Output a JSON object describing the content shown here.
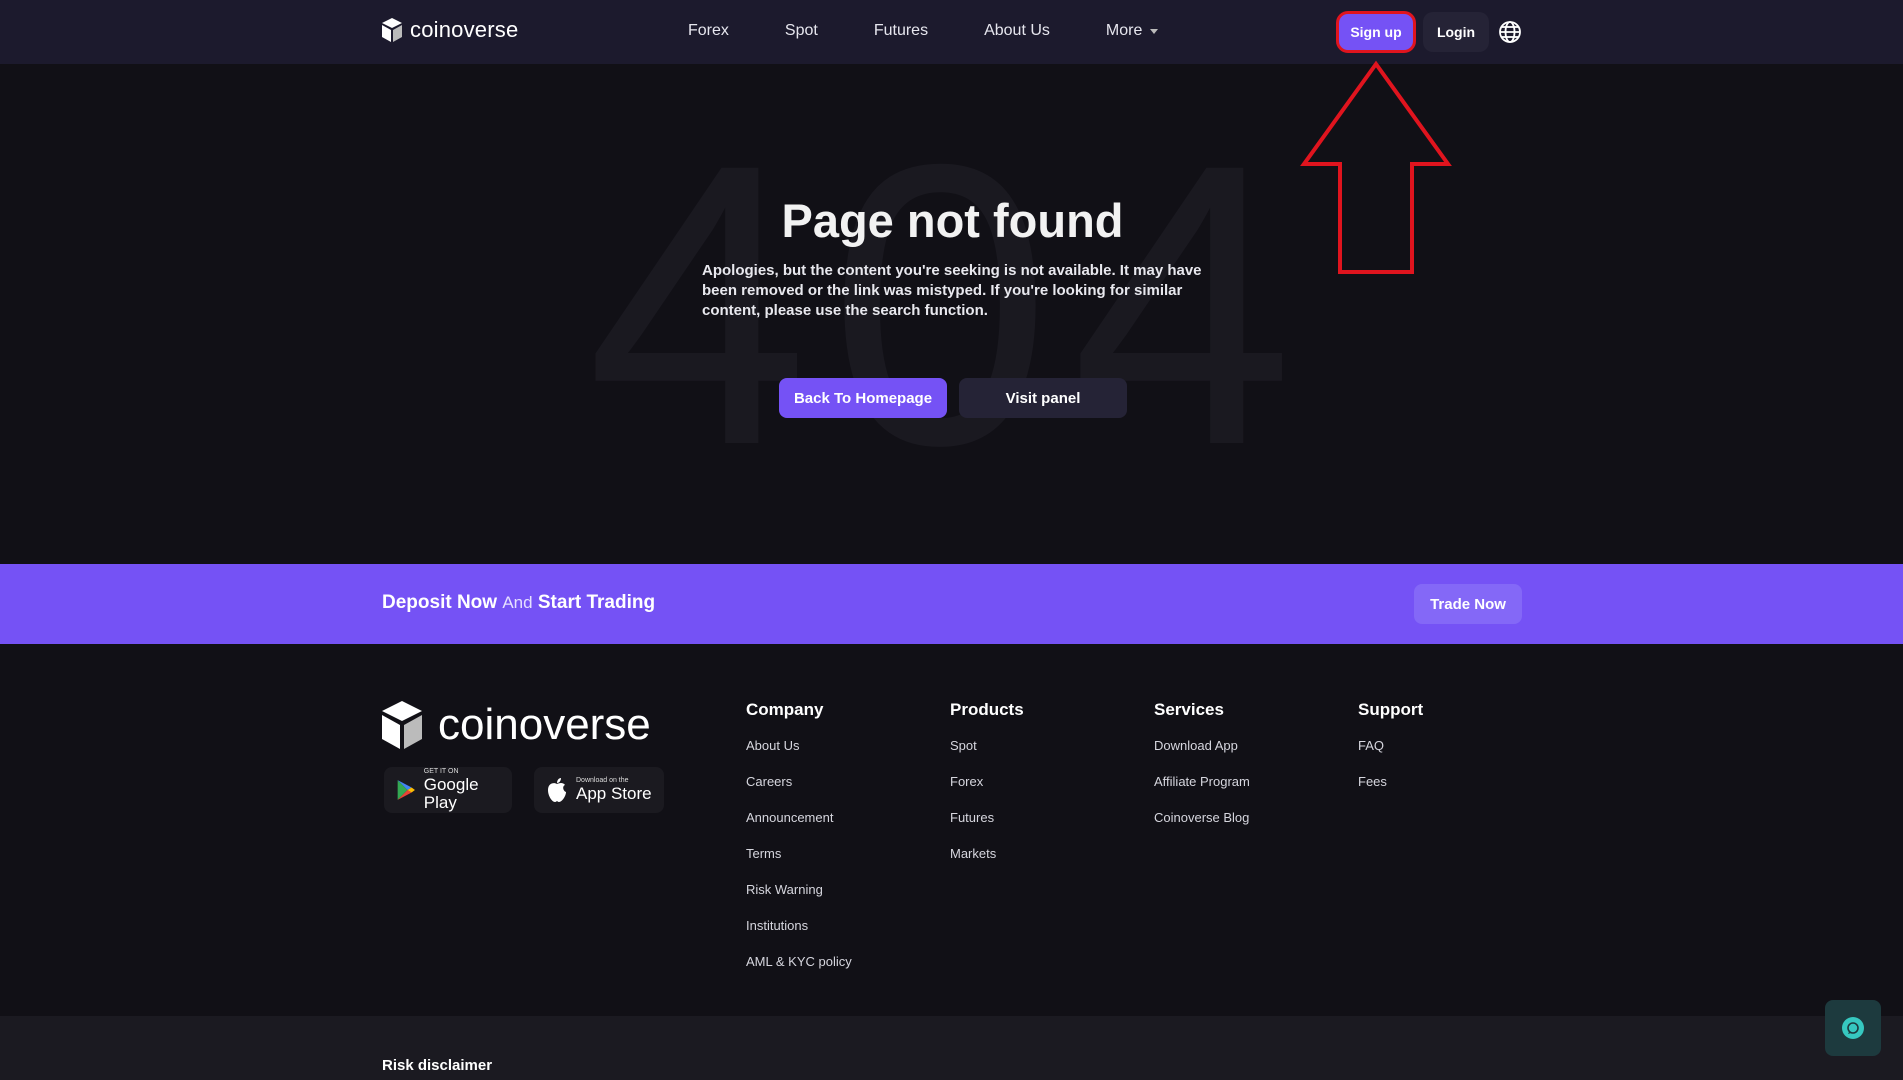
{
  "header": {
    "logo_text": "coinoverse",
    "nav": [
      "Forex",
      "Spot",
      "Futures",
      "About Us",
      "More"
    ],
    "signup_label": "Sign up",
    "login_label": "Login"
  },
  "hero": {
    "bg_text": "404",
    "title": "Page not found",
    "description": "Apologies, but the content you're seeking is not available. It may have been removed or the link was mistyped. If you're looking for similar content, please use the search function.",
    "home_button": "Back To Homepage",
    "panel_button": "Visit panel"
  },
  "banner": {
    "deposit": "Deposit Now",
    "and": "And",
    "start": "Start Trading",
    "trade_button": "Trade Now"
  },
  "footer": {
    "logo_text": "coinoverse",
    "google_play": {
      "small": "GET IT ON",
      "big": "Google Play"
    },
    "app_store": {
      "small": "Download on the",
      "big": "App Store"
    },
    "columns": [
      {
        "title": "Company",
        "items": [
          "About Us",
          "Careers",
          "Announcement",
          "Terms",
          "Risk Warning",
          "Institutions",
          "AML & KYC policy"
        ]
      },
      {
        "title": "Products",
        "items": [
          "Spot",
          "Forex",
          "Futures",
          "Markets"
        ]
      },
      {
        "title": "Services",
        "items": [
          "Download App",
          "Affiliate Program",
          "Coinoverse Blog"
        ]
      },
      {
        "title": "Support",
        "items": [
          "FAQ",
          "Fees"
        ]
      }
    ],
    "risk_disclaimer": "Risk disclaimer"
  },
  "colors": {
    "accent": "#7552f5",
    "annotation": "#e0141e",
    "chat": "#36c8c0"
  }
}
